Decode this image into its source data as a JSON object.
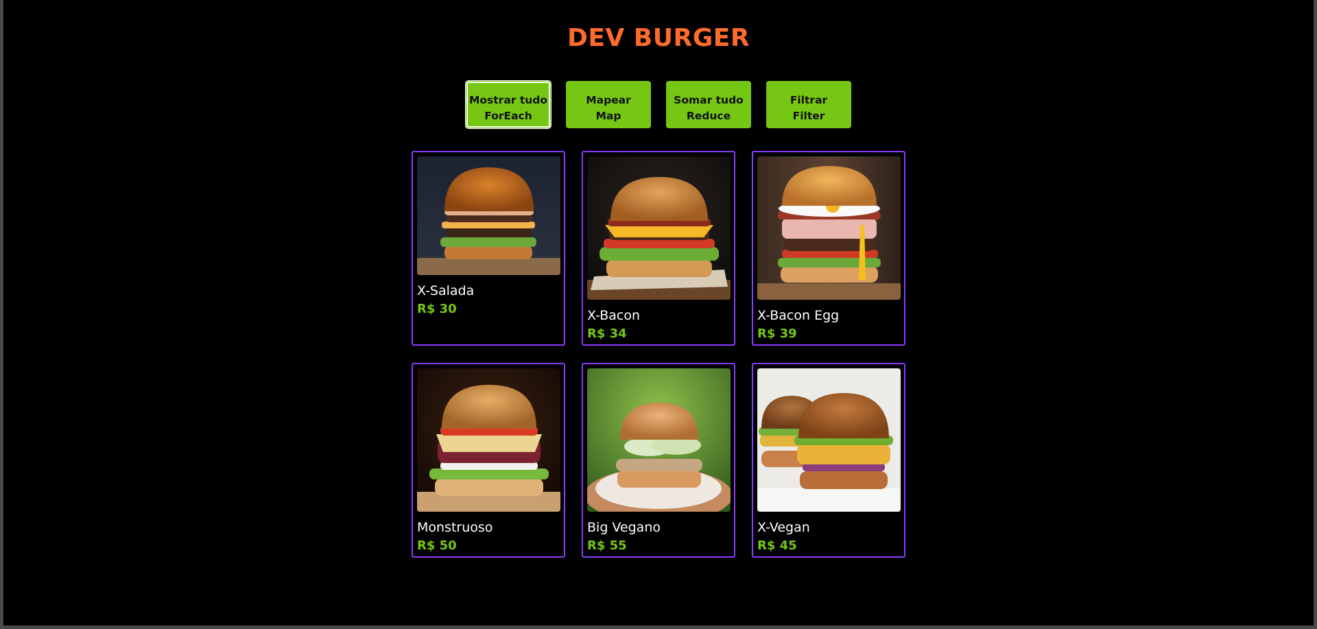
{
  "app": {
    "title": "DEV BURGER"
  },
  "toolbar": {
    "buttons": [
      {
        "line1": "Mostrar tudo",
        "line2": "ForEach",
        "active": true
      },
      {
        "line1": "Mapear",
        "line2": "Map"
      },
      {
        "line1": "Somar tudo",
        "line2": "Reduce"
      },
      {
        "line1": "Filtrar",
        "line2": "Filter"
      }
    ]
  },
  "menu": {
    "items": [
      {
        "name": "X-Salada",
        "price": "R$ 30",
        "image": "burger-image"
      },
      {
        "name": "X-Bacon",
        "price": "R$ 34",
        "image": "burger-image"
      },
      {
        "name": "X-Bacon Egg",
        "price": "R$ 39",
        "image": "burger-image"
      },
      {
        "name": "Monstruoso",
        "price": "R$ 50",
        "image": "burger-image"
      },
      {
        "name": "Big Vegano",
        "price": "R$ 55",
        "image": "burger-image"
      },
      {
        "name": "X-Vegan",
        "price": "R$ 45",
        "image": "burger-image"
      }
    ]
  },
  "colors": {
    "title": "#ff6b2c",
    "button": "#76c713",
    "price": "#76c713",
    "card_border": "#8a3cff",
    "background": "#000000"
  }
}
